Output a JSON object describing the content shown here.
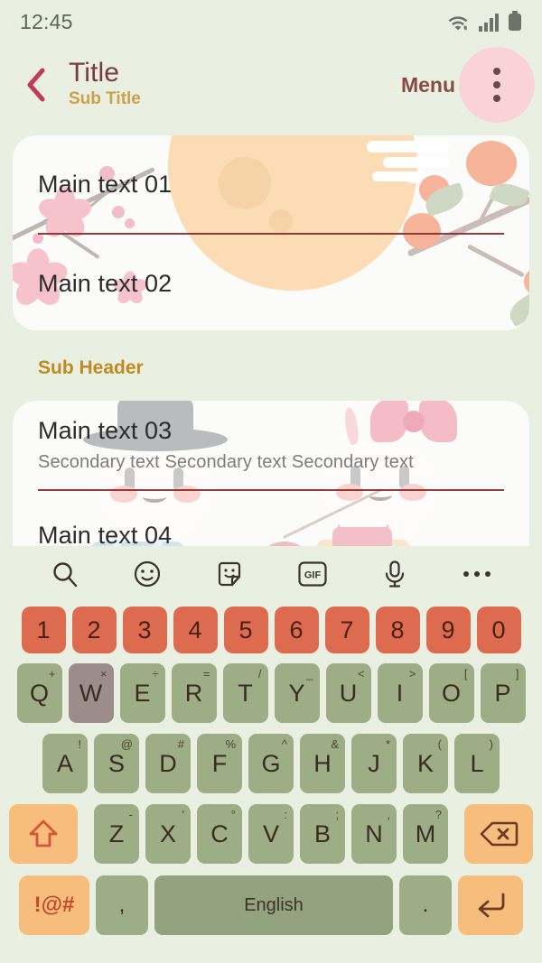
{
  "status_bar": {
    "time": "12:45",
    "icons": [
      "wifi-icon",
      "signal-icon",
      "battery-icon"
    ]
  },
  "app_bar": {
    "back_icon": "chevron-left-icon",
    "title": "Title",
    "subtitle": "Sub Title",
    "menu_label": "Menu",
    "overflow_icon": "more-vertical-icon"
  },
  "content": {
    "card_one": {
      "rows": [
        {
          "main": "Main text 01"
        },
        {
          "main": "Main text 02"
        }
      ]
    },
    "sub_header": "Sub Header",
    "card_two": {
      "rows": [
        {
          "main": "Main text 03",
          "secondary": "Secondary text Secondary text Secondary text"
        },
        {
          "main": "Main text 04"
        }
      ]
    }
  },
  "keyboard": {
    "toolbar": [
      {
        "name": "search-icon",
        "label": ""
      },
      {
        "name": "emoji-icon",
        "label": ""
      },
      {
        "name": "sticker-icon",
        "label": ""
      },
      {
        "name": "gif-icon",
        "label": "GIF"
      },
      {
        "name": "microphone-icon",
        "label": ""
      },
      {
        "name": "more-horizontal-icon",
        "label": ""
      }
    ],
    "number_row": [
      "1",
      "2",
      "3",
      "4",
      "5",
      "6",
      "7",
      "8",
      "9",
      "0"
    ],
    "row_q": [
      {
        "key": "Q",
        "alt": "+"
      },
      {
        "key": "W",
        "alt": "×",
        "pressed": true
      },
      {
        "key": "E",
        "alt": "÷"
      },
      {
        "key": "R",
        "alt": "="
      },
      {
        "key": "T",
        "alt": "/"
      },
      {
        "key": "Y",
        "alt": "_"
      },
      {
        "key": "U",
        "alt": "<"
      },
      {
        "key": "I",
        "alt": ">"
      },
      {
        "key": "O",
        "alt": "["
      },
      {
        "key": "P",
        "alt": "]"
      }
    ],
    "row_a": [
      {
        "key": "A",
        "alt": "!"
      },
      {
        "key": "S",
        "alt": "@"
      },
      {
        "key": "D",
        "alt": "#"
      },
      {
        "key": "F",
        "alt": "%"
      },
      {
        "key": "G",
        "alt": "^"
      },
      {
        "key": "H",
        "alt": "&"
      },
      {
        "key": "J",
        "alt": "*"
      },
      {
        "key": "K",
        "alt": "("
      },
      {
        "key": "L",
        "alt": ")"
      }
    ],
    "row_z": [
      {
        "key": "Z",
        "alt": "-"
      },
      {
        "key": "X",
        "alt": "'"
      },
      {
        "key": "C",
        "alt": "°"
      },
      {
        "key": "V",
        "alt": ":"
      },
      {
        "key": "B",
        "alt": ";"
      },
      {
        "key": "N",
        "alt": ","
      },
      {
        "key": "M",
        "alt": "?"
      }
    ],
    "shift_icon": "shift-arrow-up-icon",
    "backspace_icon": "backspace-delete-icon",
    "symbols_label": "!@#",
    "comma_label": ",",
    "space_label": "English",
    "period_label": ".",
    "enter_icon": "enter-return-icon"
  },
  "colors": {
    "background": "#eaf0e1",
    "title": "#7b3a42",
    "subtitle": "#cba14a",
    "sub_header": "#c08a1e",
    "menu": "#8a4a46",
    "divider": "#8a2b2b",
    "number_key": "#dd6b4f",
    "letter_key": "#9dad85",
    "function_key": "#f6bd7c",
    "space_key": "#93a37f",
    "pressed_key": "#9c8d8a",
    "ripple": "#fad3d7"
  }
}
